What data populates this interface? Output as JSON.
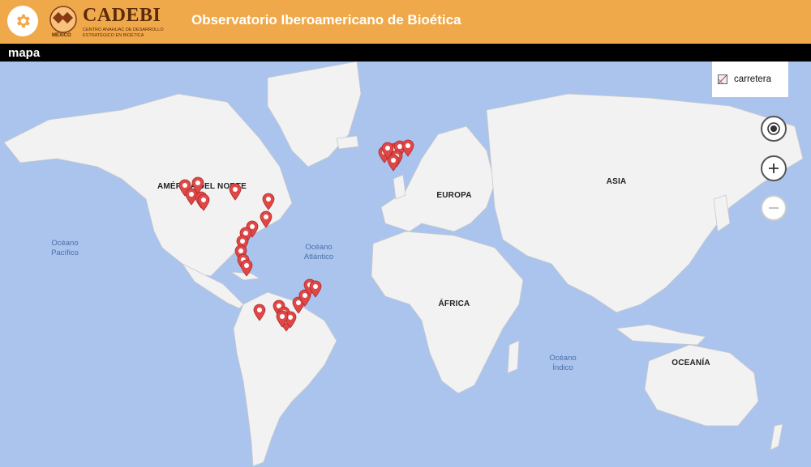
{
  "header": {
    "settings_icon": "gear-icon",
    "logo_text": "CADEBI",
    "logo_subtitle_1": "CENTRO ANAHUAC DE DESARROLLO",
    "logo_subtitle_2": "ESTRATÉGICO EN BIOÉTICA",
    "logo_country": "MÉXICO",
    "title": "Observatorio Iberoamericano de Bioética"
  },
  "subbar": {
    "label": "mapa"
  },
  "map": {
    "layer_toggle": {
      "label": "carretera",
      "icon": "map-layer-icon"
    },
    "controls": {
      "locate_icon": "target-icon",
      "zoom_in_icon": "plus-icon",
      "zoom_out_icon": "minus-icon"
    },
    "continents": {
      "north_america": "AMÉRICA DEL NORTE",
      "europe": "EUROPA",
      "asia": "ASIA",
      "africa": "ÁFRICA",
      "oceania": "OCEANÍA"
    },
    "oceans": {
      "pacific_1": "Océano",
      "pacific_2": "Pacífico",
      "atlantic_1": "Océano",
      "atlantic_2": "Atlántico",
      "indian_1": "Océano",
      "indian_2": "Índico"
    },
    "colors": {
      "ocean": "#aac4ee",
      "land": "#f2f2f2",
      "pin": "#e04848",
      "header": "#f0a94a"
    }
  }
}
